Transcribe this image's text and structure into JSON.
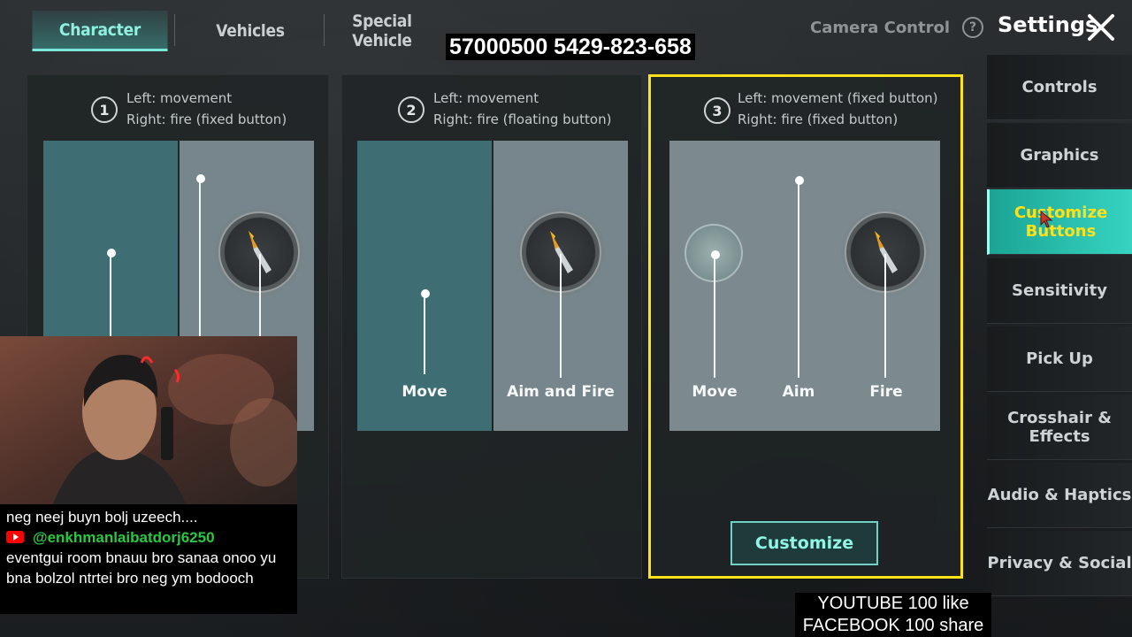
{
  "tabs": [
    {
      "label": "Character",
      "active": true
    },
    {
      "label": "Vehicles",
      "active": false
    },
    {
      "label": "Special Vehicle",
      "active": false
    }
  ],
  "camera_control": {
    "label": "Camera Control",
    "icon": "help-icon"
  },
  "header": {
    "title": "Settings",
    "close_icon": "close-icon"
  },
  "overlay_number": "57000500 5429-823-658",
  "layouts": [
    {
      "number": "1",
      "line1": "Left: movement",
      "line2": "Right: fire (fixed button)",
      "selected": false
    },
    {
      "number": "2",
      "line1": "Left: movement",
      "line2": "Right: fire (floating button)",
      "labels": [
        "Move",
        "Aim and Fire"
      ],
      "selected": false
    },
    {
      "number": "3",
      "line1": "Left: movement (fixed button)",
      "line2": "Right: fire (fixed button)",
      "labels": [
        "Move",
        "Aim",
        "Fire"
      ],
      "selected": true,
      "customize_label": "Customize"
    }
  ],
  "sidebar": {
    "items": [
      {
        "label": "Controls",
        "active": false
      },
      {
        "label": "Graphics",
        "active": false
      },
      {
        "label": "Customize Buttons",
        "active": true
      },
      {
        "label": "Sensitivity",
        "active": false
      },
      {
        "label": "Pick Up",
        "active": false
      },
      {
        "label": "Crosshair & Effects",
        "active": false
      },
      {
        "label": "Audio & Haptics",
        "active": false
      },
      {
        "label": "Privacy & Social",
        "active": false
      }
    ]
  },
  "chat": {
    "line1": "neg neej buyn bolj uzeech....",
    "username": "@enkhmanlaibatdorj6250",
    "message": "eventgui room bnauu bro sanaa onoo yu bna bolzol ntrtei bro neg ym bodooch"
  },
  "promo": {
    "line1": "YOUTUBE 100 like",
    "line2": "FACEBOOK 100 share"
  },
  "colors": {
    "accent_teal": "#36d4c2",
    "active_text_yellow": "#ffe11a",
    "selected_border": "#ffe21a",
    "youtube_red": "#ff0000",
    "chat_user_green": "#27c93f"
  }
}
